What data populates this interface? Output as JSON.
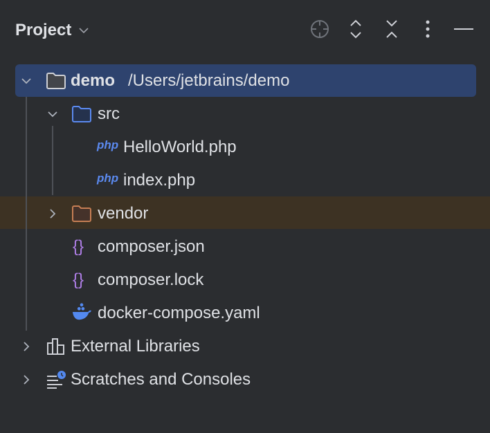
{
  "header": {
    "title": "Project"
  },
  "toolbar": {
    "locate": "locate-icon",
    "expand": "expand-all-icon",
    "collapse": "collapse-all-icon",
    "more": "more-icon",
    "hide": "minimize-icon"
  },
  "tree": {
    "root": {
      "name": "demo",
      "path": "/Users/jetbrains/demo"
    },
    "src": "src",
    "hello": "HelloWorld.php",
    "index": "index.php",
    "vendor": "vendor",
    "composer_json": "composer.json",
    "composer_lock": "composer.lock",
    "docker": "docker-compose.yaml",
    "ext": "External Libraries",
    "scratches": "Scratches and Consoles",
    "php_badge": "php"
  },
  "colors": {
    "bg": "#2b2d30",
    "selection": "#2e436e",
    "vendor_bg": "#3d3223",
    "php": "#5b8af0",
    "json": "#b07fe8",
    "docker": "#5389f0",
    "vendor_folder": "#c67e54"
  }
}
